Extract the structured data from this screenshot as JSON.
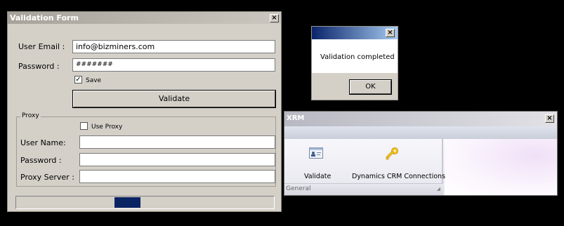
{
  "validation_form": {
    "title": "Validation Form",
    "close_glyph": "×",
    "user_email_label": "User Email :",
    "user_email_value": "info@bizminers.com",
    "password_label": "Password :",
    "password_value": "#######",
    "save_label": "Save",
    "save_checked": "✓",
    "validate_label": "Validate",
    "proxy": {
      "legend": "Proxy",
      "use_proxy_label": "Use Proxy",
      "user_name_label": "User Name:",
      "password_label": "Password :",
      "proxy_server_label": "Proxy Server :"
    },
    "progress": 0.1
  },
  "message_box": {
    "close_glyph": "×",
    "text": "Validation completed",
    "ok_label": "OK"
  },
  "xrm_window": {
    "title": "XRM",
    "close_glyph": "×",
    "ribbon_buttons": [
      {
        "label": "Validate",
        "icon": "contact-card-icon"
      },
      {
        "label": "Dynamics CRM Connections",
        "icon": "key-icon"
      }
    ],
    "group_label": "General"
  },
  "colors": {
    "progress_fill": "#0a2463",
    "active_titlebar": "#0a246a"
  }
}
